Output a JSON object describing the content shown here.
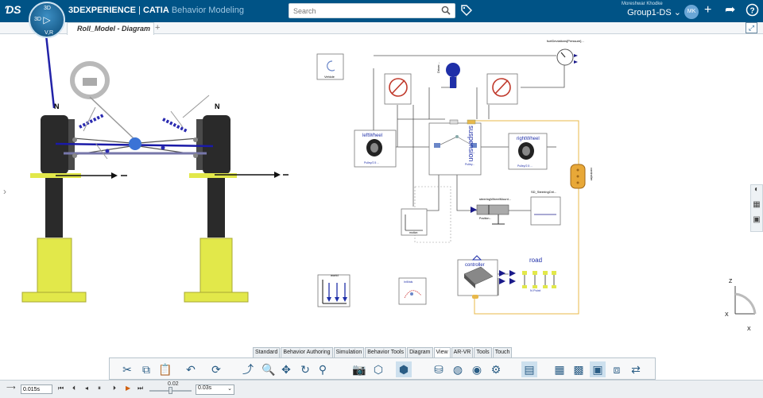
{
  "topbar": {
    "brand": "3D",
    "brand_rest": "EXPERIENCE",
    "separator": " | ",
    "app_name": "CATIA",
    "app_role": " Behavior Modeling",
    "search_placeholder": "Search",
    "user_name": "Moreshwar Khodke",
    "group": "Group1-DS",
    "avatar_initials": "MK",
    "compass_label": "V,R",
    "compass_top": "3D"
  },
  "tabs": {
    "doc_tab": "Roll_Model - Diagram",
    "add_tab": "+"
  },
  "model3d": {
    "left_label": "N",
    "right_label": "N"
  },
  "diagram": {
    "vehicle": "Vehicle",
    "left_wheel": "leftWheel",
    "right_wheel": "rightWheel",
    "suspension": "suspension",
    "suspension_sub": "Pulley...",
    "steering": "steeringWheelMount...",
    "sd_steering": "SD_SteeringCtrl...",
    "road": "road",
    "controller": "controller",
    "driver": "Driver...",
    "fuel_dev": "fuelDeviations[Pressure]...",
    "motion": "motion",
    "world": "world",
    "init_vals": "InitVals",
    "node_n": "N Point",
    "left_wheel_sub": "Pulley/2.5 ...",
    "right_wheel_sub": "Pulley/2.5 ...",
    "pos_label": "Position..."
  },
  "toolbar_tabs": [
    "Standard",
    "Behavior Authoring",
    "Simulation",
    "Behavior Tools",
    "Diagram",
    "View",
    "AR-VR",
    "Tools",
    "Touch"
  ],
  "active_tab": "View",
  "playback": {
    "time_value": "0.015s",
    "speed_value": "0.02",
    "step_value": "0.03s"
  },
  "colors": {
    "brand_bar": "#005386",
    "wheel_yellow": "#e2e84a",
    "link_blue": "#1a1aa8",
    "conn_orange": "#e8b84a"
  },
  "icons": {
    "search": "search-icon",
    "tag": "tag-icon",
    "add": "plus-icon",
    "share": "share-icon",
    "help": "help-icon"
  }
}
